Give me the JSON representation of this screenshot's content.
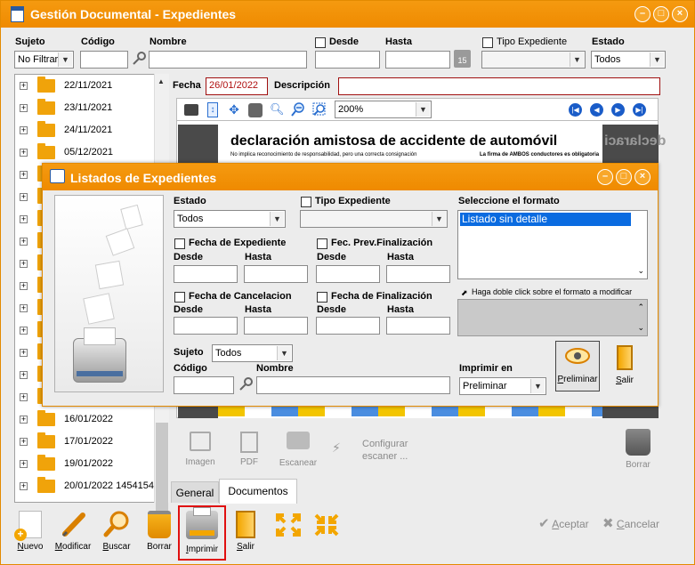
{
  "window": {
    "title": "Gestión Documental - Expedientes",
    "controls": [
      "minimize",
      "maximize",
      "close"
    ]
  },
  "filters": {
    "sujeto_label": "Sujeto",
    "sujeto_value": "No Filtrar",
    "codigo_label": "Código",
    "codigo_value": "",
    "nombre_label": "Nombre",
    "nombre_value": "",
    "desde_label": "Desde",
    "hasta_label": "Hasta",
    "calendar_day": "15",
    "tipo_label": "Tipo Expediente",
    "estado_label": "Estado",
    "estado_value": "Todos"
  },
  "tree": {
    "items": [
      "22/11/2021",
      "23/11/2021",
      "24/11/2021",
      "05/12/2021",
      "",
      "",
      "",
      "",
      "",
      "",
      "",
      "",
      "",
      "",
      "",
      "16/01/2022",
      "17/01/2022",
      "19/01/2022",
      "20/01/2022 1454154"
    ]
  },
  "document": {
    "fecha_label": "Fecha",
    "fecha_value": "26/01/2022",
    "descripcion_label": "Descripción",
    "descripcion_value": "",
    "zoom_value": "200%",
    "doc_heading": "declaración amistosa de accidente de automóvil",
    "doc_sub_left": "No implica reconocimiento de responsabilidad, pero una correcta consignación",
    "doc_sub_right": "La firma de AMBOS conductores es obligatoria",
    "doc_mirror": "declaraci"
  },
  "doc_actions": {
    "imagen": "Imagen",
    "pdf": "PDF",
    "escanear": "Escanear",
    "configurar": "Configurar escaner ...",
    "borrar": "Borrar"
  },
  "tabs": {
    "general": "General",
    "documentos": "Documentos"
  },
  "dialog": {
    "title": "Listados de Expedientes",
    "estado_label": "Estado",
    "estado_value": "Todos",
    "tipo_label": "Tipo Expediente",
    "formato_label": "Seleccione el formato",
    "formato_items": [
      "Listado sin detalle"
    ],
    "fecha_exp_label": "Fecha de Expediente",
    "fec_prev_label": "Fec. Prev.Finalización",
    "fecha_cancel_label": "Fecha de Cancelacion",
    "fecha_fin_label": "Fecha de Finalización",
    "desde_label": "Desde",
    "hasta_label": "Hasta",
    "hint": "Haga doble click sobre el formato a modificar",
    "sujeto_label": "Sujeto",
    "sujeto_value": "Todos",
    "codigo_label": "Código",
    "nombre_label": "Nombre",
    "imprimir_label": "Imprimir en",
    "imprimir_value": "Preliminar",
    "preliminar_button": "Preliminar",
    "salir_button": "Salir"
  },
  "toolbar": {
    "nuevo": "Nuevo",
    "modificar": "Modificar",
    "buscar": "Buscar",
    "borrar": "Borrar",
    "imprimir": "Imprimir",
    "salir": "Salir",
    "aceptar": "Aceptar",
    "cancelar": "Cancelar"
  },
  "colors": {
    "titlebar": "#f08c00",
    "highlight_border": "#e01010",
    "selection": "#0a6be0",
    "date_border": "#a01010"
  }
}
